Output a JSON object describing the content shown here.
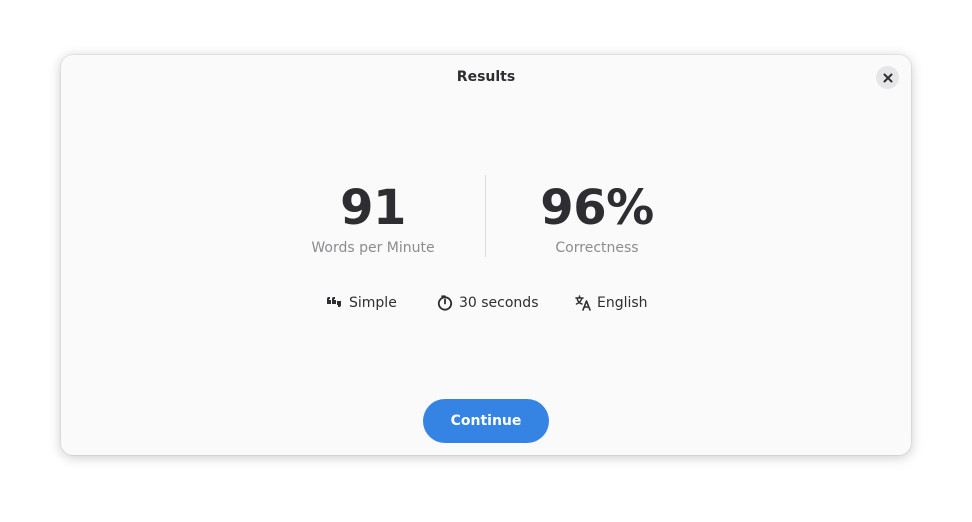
{
  "dialog": {
    "title": "Results",
    "close_icon": "close-icon"
  },
  "stats": {
    "wpm": {
      "value": "91",
      "label": "Words per Minute"
    },
    "accuracy": {
      "value": "96%",
      "label": "Correctness"
    }
  },
  "meta": {
    "text_type": {
      "icon": "quote-icon",
      "label": "Simple"
    },
    "duration": {
      "icon": "timer-icon",
      "label": "30 seconds"
    },
    "language": {
      "icon": "language-icon",
      "label": "English"
    }
  },
  "actions": {
    "continue_label": "Continue"
  },
  "colors": {
    "accent": "#3584e4",
    "text": "#2e2e32",
    "muted": "#8c8c90",
    "surface": "#fafafa"
  }
}
